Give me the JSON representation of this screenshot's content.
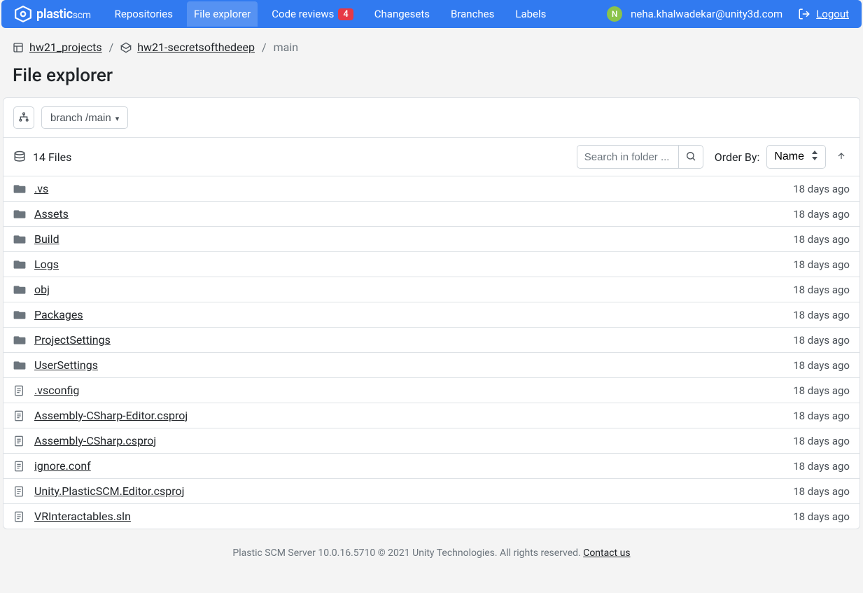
{
  "brand": {
    "name": "plastic",
    "suffix": "scm"
  },
  "nav": {
    "items": [
      {
        "label": "Repositories",
        "active": false,
        "badge": null
      },
      {
        "label": "File explorer",
        "active": true,
        "badge": null
      },
      {
        "label": "Code reviews",
        "active": false,
        "badge": "4"
      },
      {
        "label": "Changesets",
        "active": false,
        "badge": null
      },
      {
        "label": "Branches",
        "active": false,
        "badge": null
      },
      {
        "label": "Labels",
        "active": false,
        "badge": null
      }
    ]
  },
  "user": {
    "initial": "N",
    "email": "neha.khalwadekar@unity3d.com",
    "logout_label": "Logout"
  },
  "breadcrumb": {
    "org": "hw21_projects",
    "repo": "hw21-secretsofthedeep",
    "branch": "main"
  },
  "page": {
    "title": "File explorer"
  },
  "toolbar": {
    "branch_label": "branch /main",
    "file_count_label": "14 Files",
    "search_placeholder": "Search in folder ...",
    "order_by_label": "Order By:",
    "order_value": "Name"
  },
  "files": [
    {
      "name": ".vs",
      "type": "folder",
      "time": "18 days ago"
    },
    {
      "name": "Assets",
      "type": "folder",
      "time": "18 days ago"
    },
    {
      "name": "Build",
      "type": "folder",
      "time": "18 days ago"
    },
    {
      "name": "Logs",
      "type": "folder",
      "time": "18 days ago"
    },
    {
      "name": "obj",
      "type": "folder",
      "time": "18 days ago"
    },
    {
      "name": "Packages",
      "type": "folder",
      "time": "18 days ago"
    },
    {
      "name": "ProjectSettings",
      "type": "folder",
      "time": "18 days ago"
    },
    {
      "name": "UserSettings",
      "type": "folder",
      "time": "18 days ago"
    },
    {
      "name": ".vsconfig",
      "type": "file",
      "time": "18 days ago"
    },
    {
      "name": "Assembly-CSharp-Editor.csproj",
      "type": "file",
      "time": "18 days ago"
    },
    {
      "name": "Assembly-CSharp.csproj",
      "type": "file",
      "time": "18 days ago"
    },
    {
      "name": "ignore.conf",
      "type": "file",
      "time": "18 days ago"
    },
    {
      "name": "Unity.PlasticSCM.Editor.csproj",
      "type": "file",
      "time": "18 days ago"
    },
    {
      "name": "VRInteractables.sln",
      "type": "file",
      "time": "18 days ago"
    }
  ],
  "footer": {
    "text": "Plastic SCM Server 10.0.16.5710 © 2021 Unity Technologies. All rights reserved. ",
    "contact": "Contact us"
  }
}
